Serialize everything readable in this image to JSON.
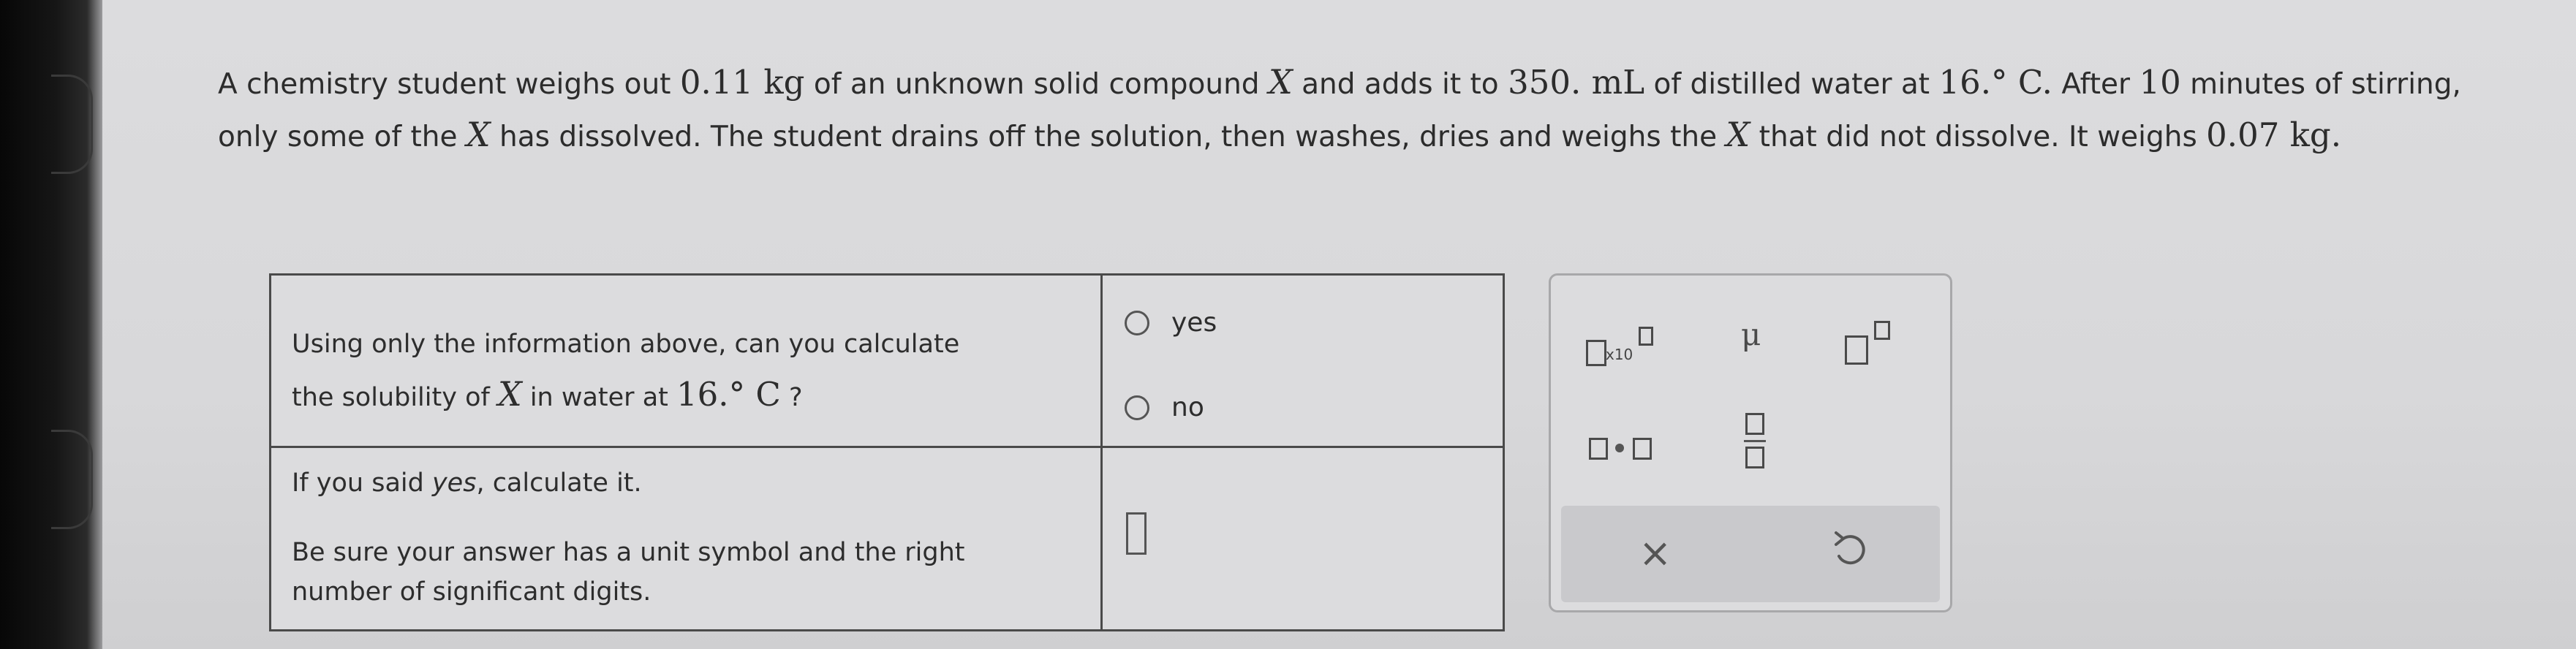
{
  "question": {
    "t1": "A chemistry student weighs out ",
    "mass_total": "0.11 kg",
    "t2": " of an unknown solid compound ",
    "compound": "X",
    "t3": " and adds it to ",
    "volume": "350. mL",
    "t4": " of distilled water at ",
    "temperature": "16.° C.",
    "t5": " After ",
    "minutes": "10",
    "t6": " minutes of stirring, only some of the ",
    "t7": " has dissolved. The student drains off the solution, then washes, dries and weighs the ",
    "t8": " that did not dissolve. It weighs ",
    "mass_left": "0.07 kg."
  },
  "part1": {
    "line1": "Using only the information above, can you calculate",
    "line2a": "the solubility of ",
    "compound": "X",
    "line2b": " in water at ",
    "temperature": "16.° C",
    "line2c": " ?",
    "options": {
      "yes": "yes",
      "no": "no"
    }
  },
  "part2": {
    "line1a": "If you said ",
    "line1b": "yes",
    "line1c": ", calculate it.",
    "line2": "Be sure your answer has a unit symbol and the right",
    "line3": "number of significant digits."
  },
  "toolbar": {
    "x10_label": "x10",
    "mu_label": "μ",
    "clear_label": "×",
    "icons": [
      "scientific-notation-icon",
      "mu-icon",
      "superscript-icon",
      "multiply-dot-icon",
      "fraction-icon",
      "clear-icon",
      "undo-icon"
    ]
  }
}
